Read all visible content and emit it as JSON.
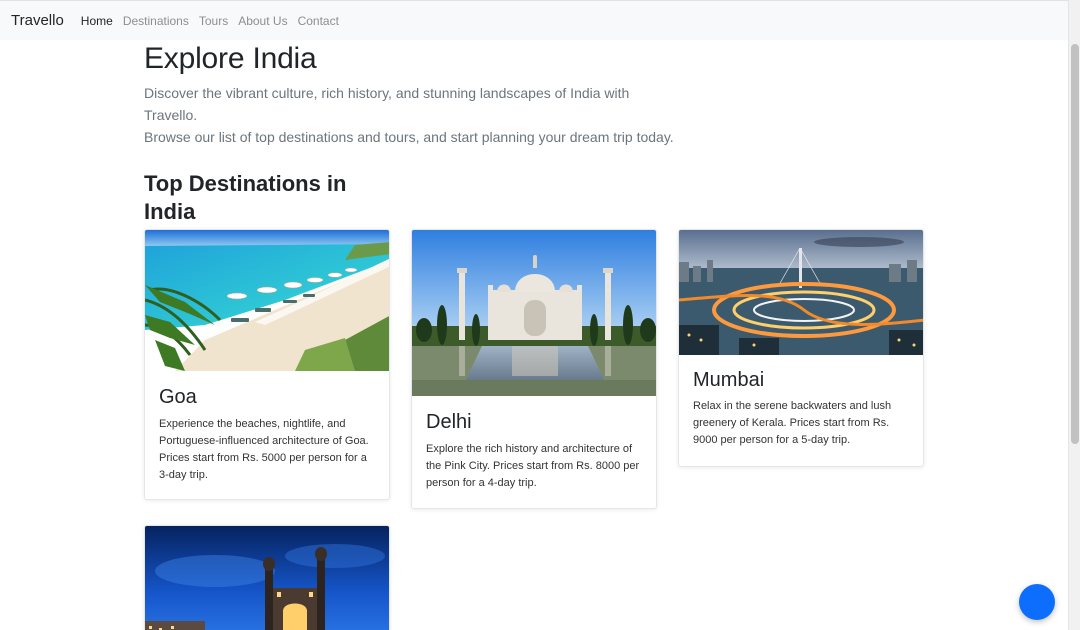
{
  "navbar": {
    "brand": "Travello",
    "links": [
      {
        "label": "Home",
        "active": true
      },
      {
        "label": "Destinations",
        "active": false
      },
      {
        "label": "Tours",
        "active": false
      },
      {
        "label": "About Us",
        "active": false
      },
      {
        "label": "Contact",
        "active": false
      }
    ]
  },
  "hero": {
    "title": "Explore India",
    "lead_line1": "Discover the vibrant culture, rich history, and stunning landscapes of India with Travello.",
    "lead_line2": "Browse our list of top destinations and tours, and start planning your dream trip today."
  },
  "destinations": {
    "heading": "Top Destinations in India",
    "cards": [
      {
        "title": "Goa",
        "text": "Experience the beaches, nightlife, and Portuguese-influenced architecture of Goa. Prices start from Rs. 5000 per person for a 3-day trip."
      },
      {
        "title": "Delhi",
        "text": "Explore the rich history and architecture of the Pink City. Prices start from Rs. 8000 per person for a 4-day trip."
      },
      {
        "title": "Mumbai",
        "text": "Relax in the serene backwaters and lush greenery of Kerala. Prices start from Rs. 9000 per person for a 5-day trip."
      },
      {
        "title": "",
        "text": ""
      }
    ]
  },
  "colors": {
    "primary": "#0d6efd",
    "navbar_bg": "#f8f9fa",
    "muted_text": "#6c757d"
  }
}
